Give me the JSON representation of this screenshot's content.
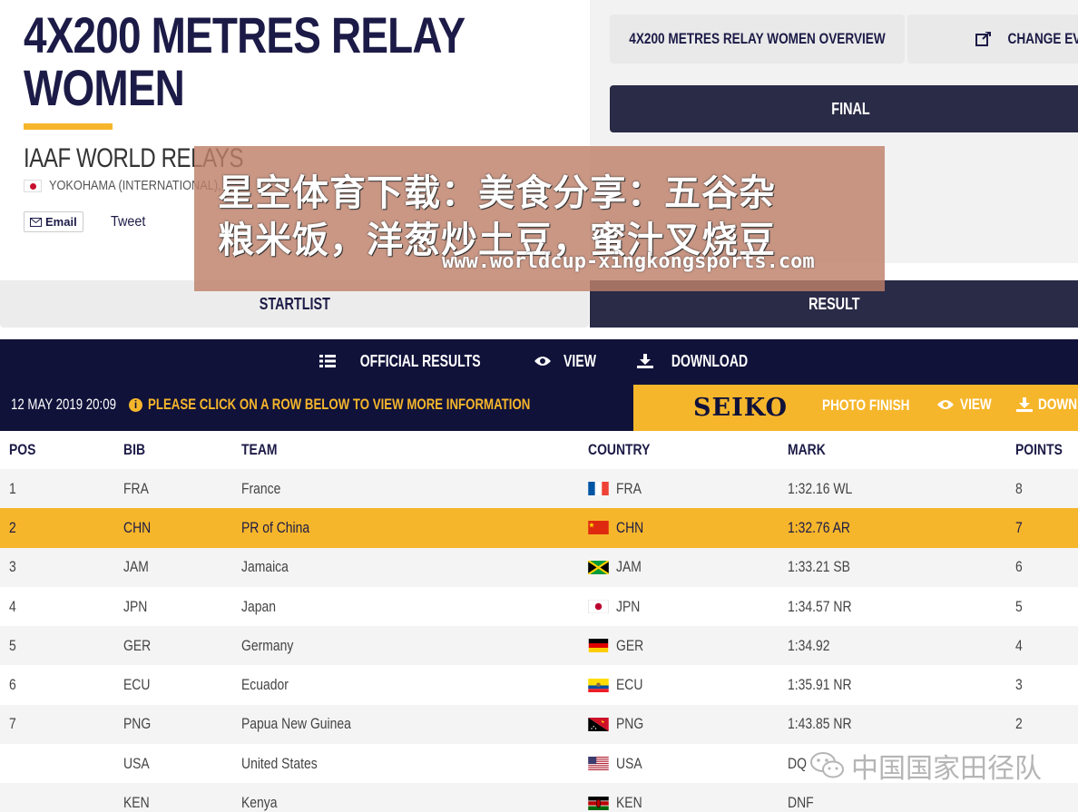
{
  "header": {
    "title_line1": "4X200 METRES RELAY",
    "title_line2": "WOMEN",
    "event_name": "IAAF WORLD RELAYS",
    "venue": "YOKOHAMA (INTERNATIONAL),",
    "email_label": "Email",
    "tweet_label": "Tweet"
  },
  "right": {
    "overview_label": "4X200 METRES RELAY WOMEN OVERVIEW",
    "change_label": "CHANGE EVENT",
    "final_label": "FINAL"
  },
  "tabs": {
    "startlist": "STARTLIST",
    "result": "RESULT"
  },
  "toolbar": {
    "official_results": "OFFICIAL RESULTS",
    "view": "VIEW",
    "download": "DOWNLOAD",
    "date": "12 MAY 2019 20:09",
    "notice": "PLEASE CLICK ON A ROW BELOW TO VIEW MORE INFORMATION",
    "seiko": "SEIKO",
    "photo_finish": "PHOTO FINISH",
    "seiko_view": "VIEW",
    "seiko_download": "DOWN"
  },
  "table": {
    "headers": [
      "POS",
      "BIB",
      "TEAM",
      "COUNTRY",
      "MARK",
      "POINTS"
    ],
    "rows": [
      {
        "pos": "1",
        "bib": "FRA",
        "team": "France",
        "country": "FRA",
        "mark": "1:32.16 WL",
        "points": "8"
      },
      {
        "pos": "2",
        "bib": "CHN",
        "team": "PR of China",
        "country": "CHN",
        "mark": "1:32.76 AR",
        "points": "7"
      },
      {
        "pos": "3",
        "bib": "JAM",
        "team": "Jamaica",
        "country": "JAM",
        "mark": "1:33.21 SB",
        "points": "6"
      },
      {
        "pos": "4",
        "bib": "JPN",
        "team": "Japan",
        "country": "JPN",
        "mark": "1:34.57 NR",
        "points": "5"
      },
      {
        "pos": "5",
        "bib": "GER",
        "team": "Germany",
        "country": "GER",
        "mark": "1:34.92",
        "points": "4"
      },
      {
        "pos": "6",
        "bib": "ECU",
        "team": "Ecuador",
        "country": "ECU",
        "mark": "1:35.91 NR",
        "points": "3"
      },
      {
        "pos": "7",
        "bib": "PNG",
        "team": "Papua New Guinea",
        "country": "PNG",
        "mark": "1:43.85 NR",
        "points": "2"
      },
      {
        "pos": "",
        "bib": "USA",
        "team": "United States",
        "country": "USA",
        "mark": "DQ",
        "points": ""
      },
      {
        "pos": "",
        "bib": "KEN",
        "team": "Kenya",
        "country": "KEN",
        "mark": "DNF",
        "points": ""
      }
    ]
  },
  "overlay": {
    "line1": "星空体育下载：美食分享：五谷杂",
    "line2": "粮米饭，洋葱炒土豆，蜜汁叉烧豆",
    "url": "www.worldcup-xingkongsports.com",
    "watermark": "中国国家田径队"
  },
  "colors": {
    "navy": "#10123a",
    "accent": "#f6b62b",
    "dark_button": "#2a2b47"
  }
}
